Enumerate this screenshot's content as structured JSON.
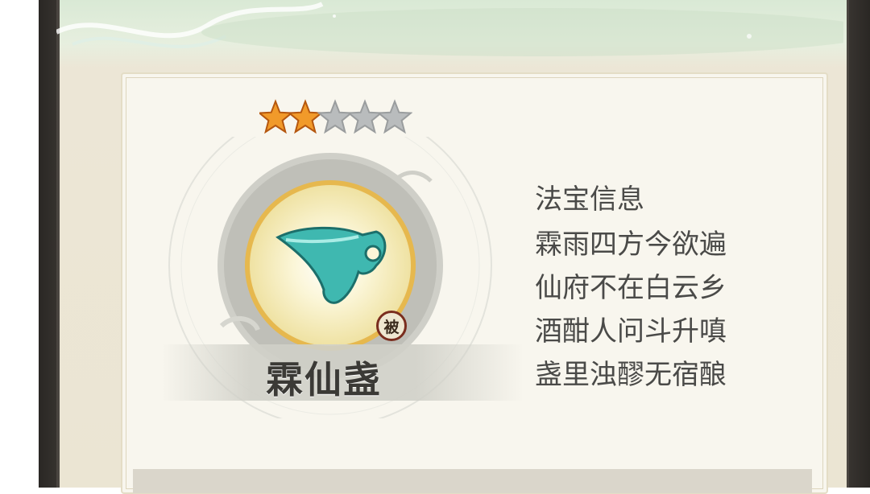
{
  "item": {
    "name": "霖仙盏",
    "star_rating": 2,
    "star_max": 5,
    "passive_badge": "被",
    "icon": "jade-cup-icon"
  },
  "info": {
    "title": "法宝信息",
    "poem": [
      "霖雨四方今欲遍",
      "仙府不在白云乡",
      "酒酣人问斗升嗔",
      "盏里浊醪无宿酿"
    ]
  },
  "colors": {
    "star_filled": "#f19a2a",
    "star_empty": "#b9bcbd",
    "card_bg": "#f8f6ee",
    "text": "#4a4a48",
    "emblem_ring": "#e3b54a",
    "cup": "#3fb8b0"
  }
}
